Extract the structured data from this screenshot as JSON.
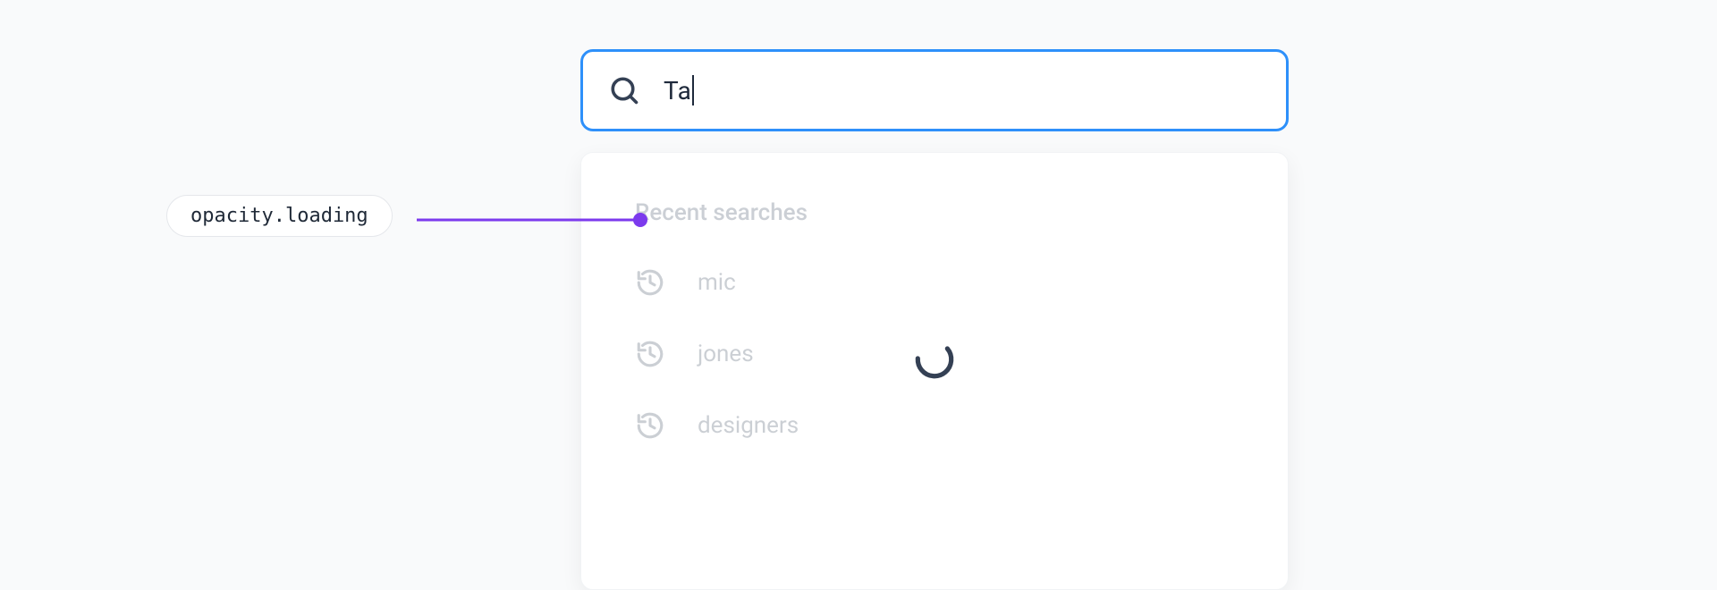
{
  "annotation": {
    "label": "opacity.loading"
  },
  "search": {
    "value": "Ta"
  },
  "dropdown": {
    "heading": "Recent searches",
    "items": [
      {
        "label": "mic"
      },
      {
        "label": "jones"
      },
      {
        "label": "designers"
      }
    ]
  },
  "colors": {
    "focus_ring": "#2e90fa",
    "annotation_line": "#7c3aed",
    "text": "#1e293b",
    "muted": "#475569",
    "spinner": "#344054"
  }
}
